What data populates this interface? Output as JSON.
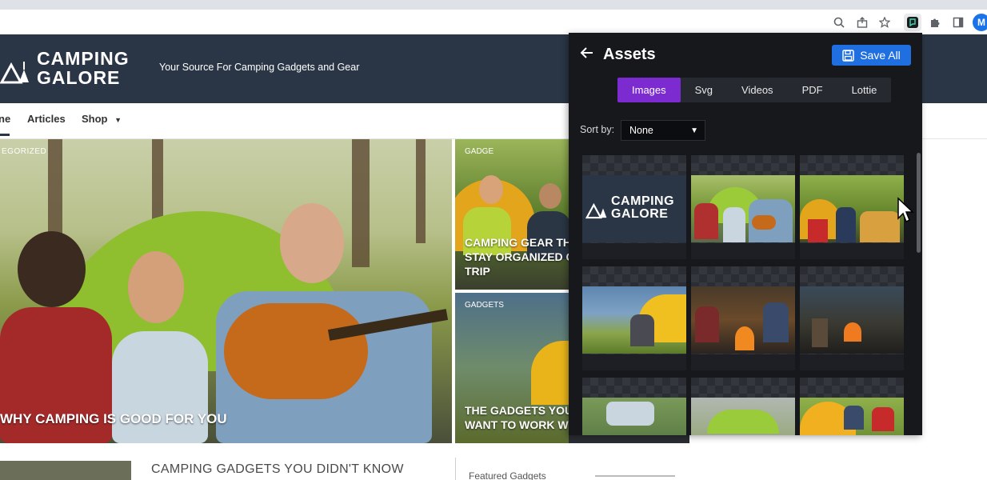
{
  "browser": {
    "avatar_letter": "M",
    "icons": [
      "zoom-icon",
      "share-icon",
      "bookmark-star-icon",
      "extension-active-icon",
      "puzzle-icon",
      "side-panel-icon"
    ]
  },
  "site": {
    "logo_line1": "CAMPING",
    "logo_line2": "GALORE",
    "tagline": "Your Source For Camping Gadgets and Gear",
    "nav": [
      "ne",
      "Articles",
      "Shop"
    ],
    "hero": {
      "category": "EGORIZED",
      "title": "WHY CAMPING IS GOOD FOR YOU"
    },
    "cards": [
      {
        "category": "GADGE",
        "title_line1": "CAMPING GEAR TH",
        "title_line2": "STAY ORGANIZED C",
        "title_line3": "TRIP"
      },
      {
        "category": "GADGETS",
        "title_line1": "THE GADGETS YOU",
        "title_line2": "WANT TO WORK W"
      }
    ],
    "below_title": "CAMPING GADGETS YOU DIDN'T KNOW",
    "featured": "Featured Gadgets"
  },
  "panel": {
    "title": "Assets",
    "save_label": "Save All",
    "tabs": [
      "Images",
      "Svg",
      "Videos",
      "PDF",
      "Lottie"
    ],
    "active_tab": "Images",
    "sort_label": "Sort by:",
    "sort_value": "None",
    "asset_logo_line1": "CAMPING",
    "asset_logo_line2": "GALORE"
  },
  "colors": {
    "header_bg": "#2a3646",
    "panel_bg": "#16181c",
    "active_tab": "#7b2bd0",
    "save_button": "#1f6fe0"
  }
}
